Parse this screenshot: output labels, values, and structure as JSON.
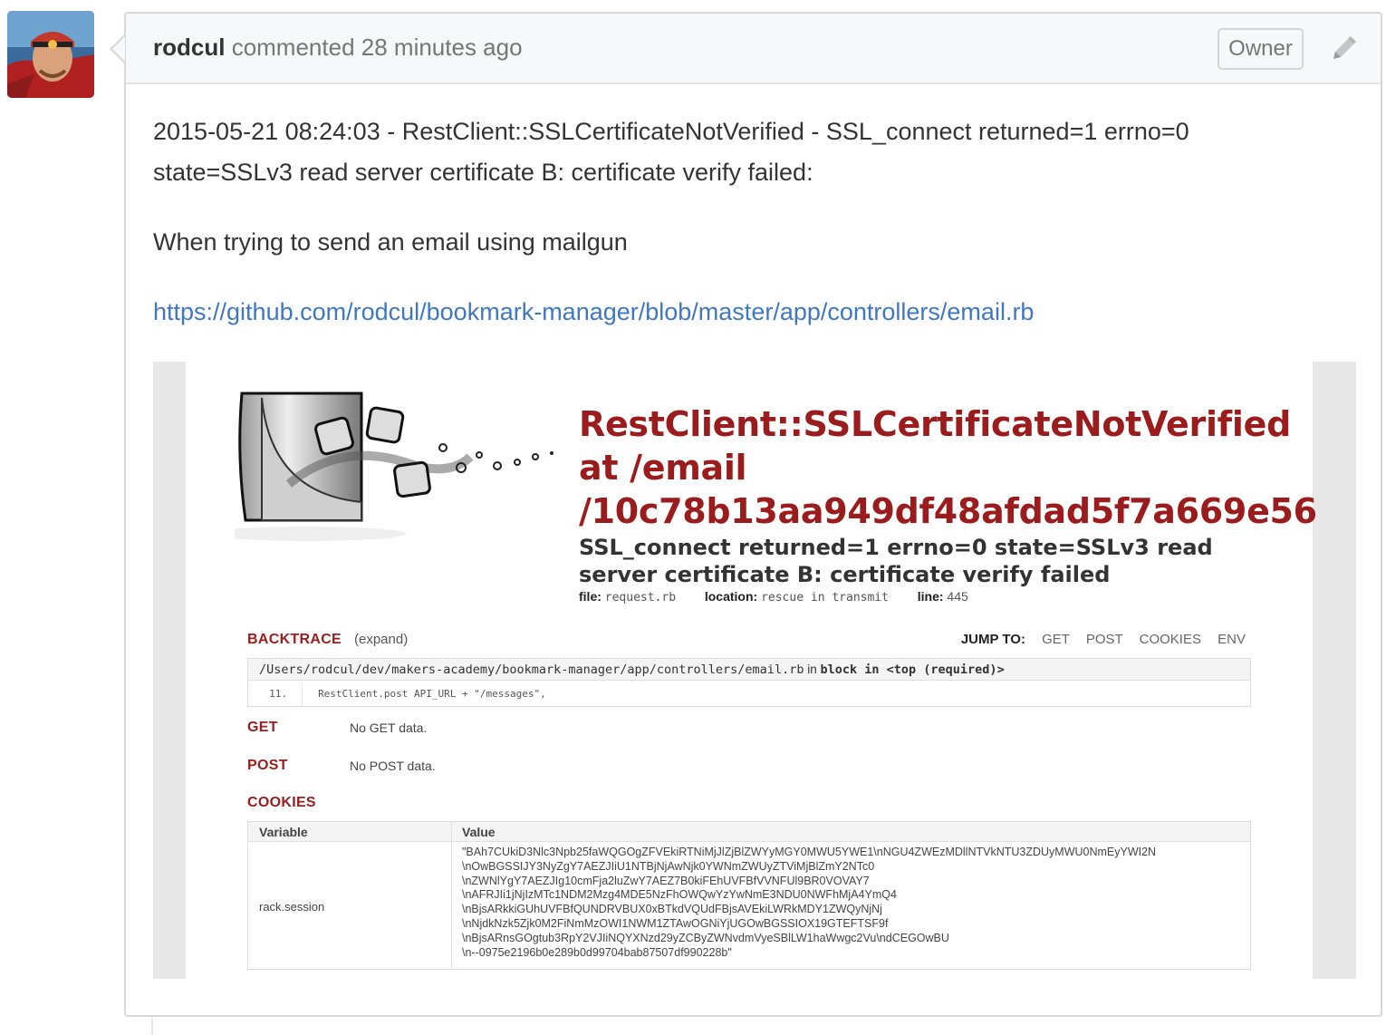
{
  "comment": {
    "author": "rodcul",
    "action": "commented",
    "time": "28 minutes ago",
    "badge": "Owner",
    "paragraph1_line1": "2015-05-21 08:24:03 - RestClient::SSLCertificateNotVerified - SSL_connect returned=1 errno=0",
    "paragraph1_line2": "state=SSLv3 read server certificate B: certificate verify failed:",
    "paragraph2": "When trying to send an email using mailgun",
    "link": "https://github.com/rodcul/bookmark-manager/blob/master/app/controllers/email.rb"
  },
  "error_page": {
    "title_line1": "RestClient::SSLCertificateNotVerified",
    "title_line2": "at /email",
    "title_line3": "/10c78b13aa949df48afdad5f7a669e56",
    "message": "SSL_connect returned=1 errno=0 state=SSLv3 read server certificate B: certificate verify failed",
    "file_label": "file:",
    "file_value": "request.rb",
    "location_label": "location:",
    "location_value": "rescue in transmit",
    "line_label": "line:",
    "line_value": "445",
    "backtrace_heading": "BACKTRACE",
    "expand_label": "(expand)",
    "jump_to_label": "JUMP TO:",
    "jump_links": [
      "GET",
      "POST",
      "COOKIES",
      "ENV"
    ],
    "trace_path": "/Users/rodcul/dev/makers-academy/bookmark-manager/app/controllers/email.rb",
    "trace_in": "in",
    "trace_context": "block in <top (required)>",
    "trace_line_number": "11.",
    "trace_code": "RestClient.post API_URL + \"/messages\",",
    "get_heading": "GET",
    "get_text": "No GET data.",
    "post_heading": "POST",
    "post_text": "No POST data.",
    "cookies_heading": "COOKIES",
    "cookie_col_variable": "Variable",
    "cookie_col_value": "Value",
    "cookie_name": "rack.session",
    "cookie_value": "\"BAh7CUkiD3Nlc3Npb25faWQGOgZFVEkiRTNiMjJlZjBlZWYyMGY0MWU5YWE1\\nNGU4ZWEzMDllNTVkNTU3ZDUyMWU0NmEyYWI2N\n\\nOwBGSSIJY3NyZgY7AEZJIiU1NTBjNjAwNjk0YWNmZWUyZTViMjBlZmY2NTc0\n\\nZWNlYgY7AEZJIg10cmFja2luZwY7AEZ7B0kiFEhUVFBfVVNFUl9BR0VOVAY7\n\\nAFRJIi1jNjIzMTc1NDM2Mzg4MDE5NzFhOWQwYzYwNmE3NDU0NWFhMjA4YmQ4\n\\nBjsARkkiGUhUVFBfQUNDRVBUX0xBTkdVQUdFBjsAVEkiLWRkMDY1ZWQyNjNj\n\\nNjdkNzk5Zjk0M2FiNmMzOWI1NWM1ZTAwOGNiYjUGOwBGSSIOX19GTEFTSF9f\n\\nBjsARnsGOgtub3RpY2VJIiNQYXNzd29yZCByZWNvdmVyeSBlLW1haWwgc2Vu\\ndCEGOwBU\n\\n--0975e2196b0e289b0d99704bab87507df990228b\""
  },
  "colors": {
    "error_red": "#9b1c1c",
    "link_blue": "#4078c0",
    "header_bg": "#f6f8fa"
  },
  "icons": {
    "avatar": "user-avatar-photo",
    "edit": "pencil-icon",
    "hero": "broken-glass-splash-illustration"
  }
}
